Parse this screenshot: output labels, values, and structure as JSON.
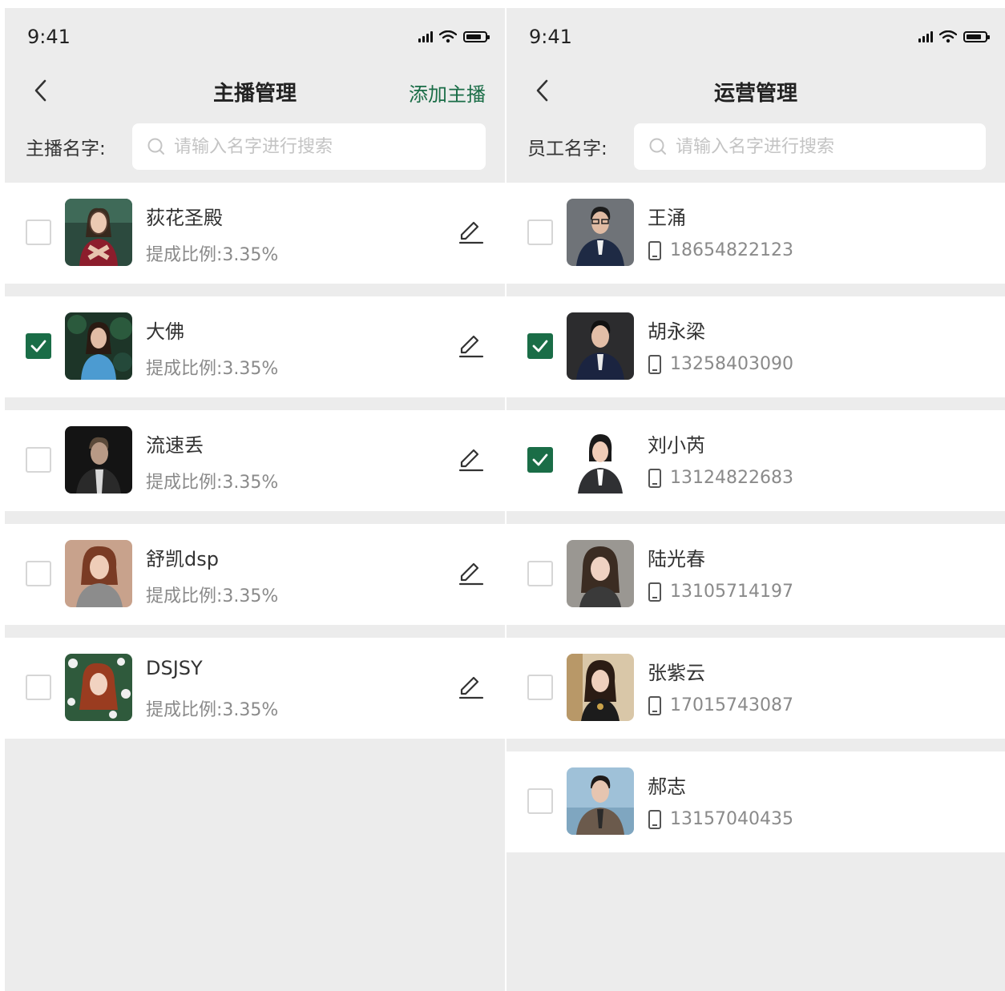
{
  "colors": {
    "accent": "#1a6d47",
    "background": "#ececec",
    "card": "#ffffff"
  },
  "left": {
    "status": {
      "time": "9:41"
    },
    "nav": {
      "title": "主播管理",
      "action": "添加主播"
    },
    "search": {
      "label": "主播名字:",
      "placeholder": "请输入名字进行搜索",
      "value": ""
    },
    "items": [
      {
        "name": "荻花圣殿",
        "ratio": "提成比例:3.35%",
        "checked": false,
        "avatar": "avatar-woman-red-dress"
      },
      {
        "name": "大佛",
        "ratio": "提成比例:3.35%",
        "checked": true,
        "avatar": "avatar-woman-blue-top"
      },
      {
        "name": "流速丢",
        "ratio": "提成比例:3.35%",
        "checked": false,
        "avatar": "avatar-man-dark"
      },
      {
        "name": "舒凯dsp",
        "ratio": "提成比例:3.35%",
        "checked": false,
        "avatar": "avatar-woman-tshirt"
      },
      {
        "name": "DSJSY",
        "ratio": "提成比例:3.35%",
        "checked": false,
        "avatar": "avatar-woman-flowers"
      }
    ]
  },
  "right": {
    "status": {
      "time": "9:41"
    },
    "nav": {
      "title": "运营管理"
    },
    "search": {
      "label": "员工名字:",
      "placeholder": "请输入名字进行搜索",
      "value": ""
    },
    "items": [
      {
        "name": "王涌",
        "phone": "18654822123",
        "checked": false,
        "avatar": "avatar-man-suit-glasses"
      },
      {
        "name": "胡永梁",
        "phone": "13258403090",
        "checked": true,
        "avatar": "avatar-man-suit"
      },
      {
        "name": "刘小芮",
        "phone": "13124822683",
        "checked": true,
        "avatar": "avatar-woman-suit"
      },
      {
        "name": "陆光春",
        "phone": "13105714197",
        "checked": false,
        "avatar": "avatar-woman-portrait"
      },
      {
        "name": "张紫云",
        "phone": "17015743087",
        "checked": false,
        "avatar": "avatar-woman-dress"
      },
      {
        "name": "郝志",
        "phone": "13157040435",
        "checked": false,
        "avatar": "avatar-man-blazer"
      }
    ]
  }
}
